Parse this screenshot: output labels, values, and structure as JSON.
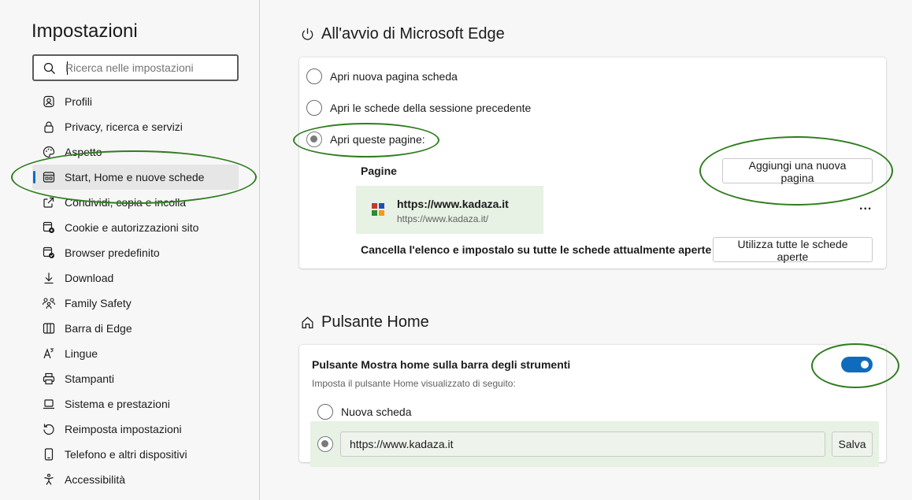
{
  "sidebar": {
    "title": "Impostazioni",
    "search_placeholder": "Ricerca nelle impostazioni",
    "items": [
      {
        "label": "Profili",
        "icon": "profile-icon"
      },
      {
        "label": "Privacy, ricerca e servizi",
        "icon": "lock-icon"
      },
      {
        "label": "Aspetto",
        "icon": "palette-icon"
      },
      {
        "label": "Start, Home e nuove schede",
        "icon": "tabs-window-icon"
      },
      {
        "label": "Condividi, copia e incolla",
        "icon": "share-icon"
      },
      {
        "label": "Cookie e autorizzazioni sito",
        "icon": "cookie-permissions-icon"
      },
      {
        "label": "Browser predefinito",
        "icon": "default-browser-icon"
      },
      {
        "label": "Download",
        "icon": "download-icon"
      },
      {
        "label": "Family Safety",
        "icon": "family-icon"
      },
      {
        "label": "Barra di Edge",
        "icon": "edge-bar-icon"
      },
      {
        "label": "Lingue",
        "icon": "language-icon"
      },
      {
        "label": "Stampanti",
        "icon": "printer-icon"
      },
      {
        "label": "Sistema e prestazioni",
        "icon": "laptop-icon"
      },
      {
        "label": "Reimposta impostazioni",
        "icon": "reset-icon"
      },
      {
        "label": "Telefono e altri dispositivi",
        "icon": "phone-icon"
      },
      {
        "label": "Accessibilità",
        "icon": "accessibility-icon"
      }
    ]
  },
  "startup": {
    "title": "All'avvio di Microsoft Edge",
    "options": [
      {
        "label": "Apri nuova pagina scheda",
        "checked": false
      },
      {
        "label": "Apri le schede della sessione precedente",
        "checked": false
      },
      {
        "label": "Apri queste pagine:",
        "checked": true
      }
    ],
    "pages_heading": "Pagine",
    "add_page_button": "Aggiungi una nuova pagina",
    "page": {
      "title": "https://www.kadaza.it",
      "url": "https://www.kadaza.it/"
    },
    "more_options": "...",
    "clear_label": "Cancella l'elenco e impostalo su tutte le schede attualmente aperte",
    "use_open_tabs_button": "Utilizza tutte le schede aperte"
  },
  "home": {
    "title": "Pulsante Home",
    "toggle_label": "Pulsante Mostra home sulla barra degli strumenti",
    "toggle_sub": "Imposta il pulsante Home visualizzato di seguito:",
    "toggle_on": true,
    "options": [
      {
        "label": "Nuova scheda",
        "checked": false
      }
    ],
    "url_value": "https://www.kadaza.it",
    "save_button": "Salva"
  },
  "colors": {
    "accent": "#0f6cbd",
    "annotation": "#2e7d1e",
    "highlight": "#e7f1e4"
  }
}
